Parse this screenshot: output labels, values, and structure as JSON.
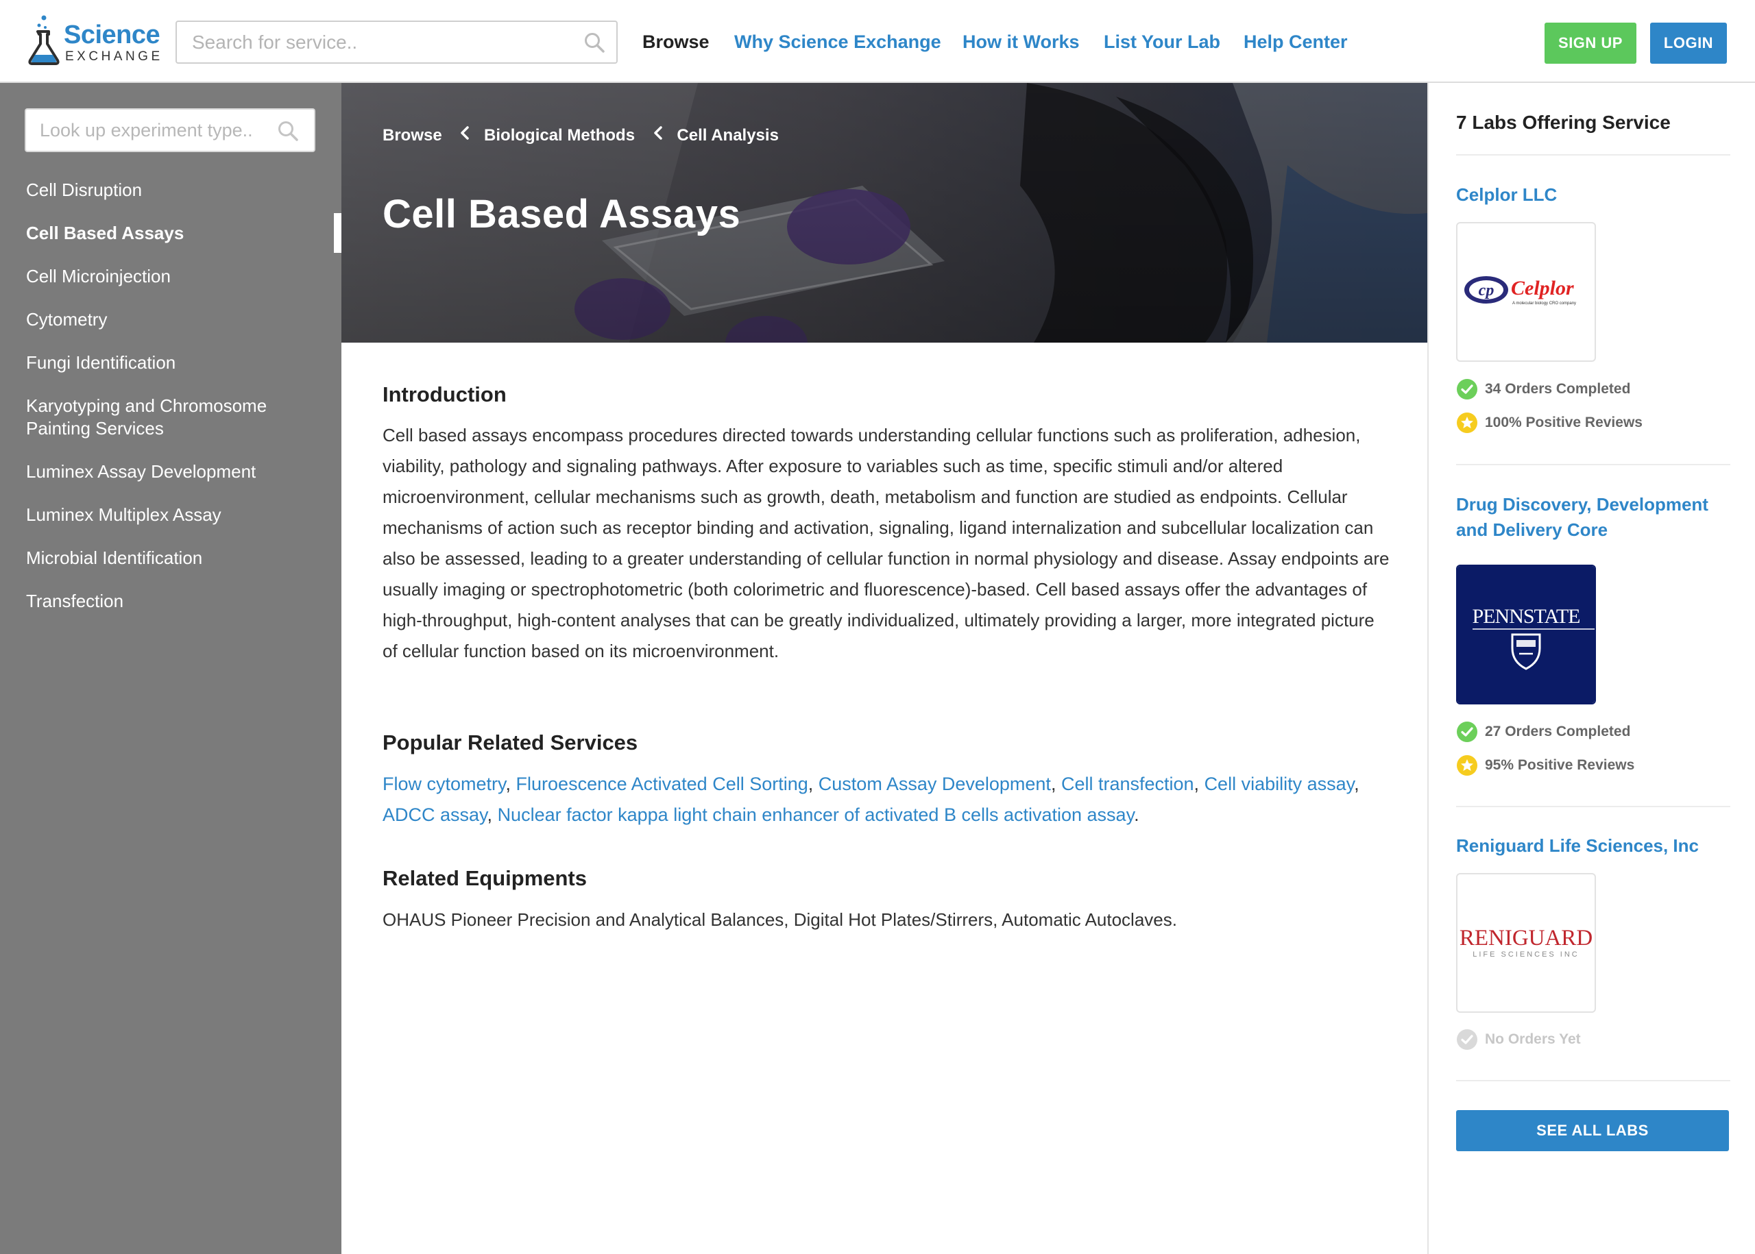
{
  "brand": {
    "name_top": "Science",
    "name_bottom": "EXCHANGE"
  },
  "header": {
    "search_placeholder": "Search for service..",
    "nav": [
      {
        "label": "Browse",
        "active": true
      },
      {
        "label": "Why Science Exchange",
        "active": false
      },
      {
        "label": "How it Works",
        "active": false
      },
      {
        "label": "List Your Lab",
        "active": false
      },
      {
        "label": "Help Center",
        "active": false
      }
    ],
    "signup_label": "SIGN UP",
    "login_label": "LOGIN"
  },
  "sidebar": {
    "search_placeholder": "Look up experiment type..",
    "items": [
      {
        "label": "Cell Disruption",
        "active": false
      },
      {
        "label": "Cell Based Assays",
        "active": true
      },
      {
        "label": "Cell Microinjection",
        "active": false
      },
      {
        "label": "Cytometry",
        "active": false
      },
      {
        "label": "Fungi Identification",
        "active": false
      },
      {
        "label": "Karyotyping and Chromosome Painting Services",
        "active": false
      },
      {
        "label": "Luminex Assay Development",
        "active": false
      },
      {
        "label": "Luminex Multiplex Assay",
        "active": false
      },
      {
        "label": "Microbial Identification",
        "active": false
      },
      {
        "label": "Transfection",
        "active": false
      }
    ]
  },
  "hero": {
    "breadcrumb": [
      "Browse",
      "Biological Methods",
      "Cell Analysis"
    ],
    "title": "Cell Based Assays"
  },
  "main": {
    "introduction": {
      "heading": "Introduction",
      "text": "Cell based assays encompass procedures directed towards understanding cellular functions such as proliferation, adhesion, viability, pathology and signaling pathways. After exposure to variables such as time, specific stimuli and/or altered microenvironment, cellular mechanisms such as growth, death, metabolism and function are studied as endpoints. Cellular mechanisms of action such as receptor binding and activation, signaling, ligand internalization and subcellular localization can also be assessed, leading to a greater understanding of cellular function in normal physiology and disease. Assay endpoints are usually imaging or spectrophotometric (both colorimetric and fluorescence)-based. Cell based assays offer the advantages of high-throughput, high-content analyses that can be greatly individualized, ultimately providing a larger, more integrated picture of cellular function based on its microenvironment."
    },
    "popular_related": {
      "heading": "Popular Related Services",
      "links": [
        "Flow cytometry",
        "Fluroescence Activated Cell Sorting",
        "Custom Assay Development",
        "Cell transfection",
        "Cell viability assay",
        "ADCC assay",
        "Nuclear factor kappa light chain enhancer of activated B cells activation assay"
      ]
    },
    "related_equipments": {
      "heading": "Related Equipments",
      "text": "OHAUS Pioneer Precision and Analytical Balances, Digital Hot Plates/Stirrers, Automatic Autoclaves."
    }
  },
  "labs_panel": {
    "heading": "7 Labs Offering Service",
    "labs": [
      {
        "name": "Celplor LLC",
        "logo_icon": "celplor-logo",
        "logo_text": {
          "initials": "cp",
          "word": "Celplor",
          "tagline": "A molecular biology CRO company"
        },
        "orders": "34 Orders Completed",
        "reviews": "100% Positive Reviews"
      },
      {
        "name": "Drug Discovery, Development and Delivery Core",
        "logo_icon": "pennstate-logo",
        "logo_text": {
          "word": "PENNSTATE"
        },
        "orders": "27 Orders Completed",
        "reviews": "95% Positive Reviews"
      },
      {
        "name": "Reniguard Life Sciences, Inc",
        "logo_icon": "reniguard-logo",
        "logo_text": {
          "word": "RENIGUARD",
          "tagline": "LIFE SCIENCES INC"
        },
        "orders": "No Orders Yet",
        "reviews": null
      }
    ],
    "see_all_label": "SEE ALL LABS"
  },
  "colors": {
    "link_blue": "#2e86c8",
    "signup_green": "#5cc85c",
    "sidebar_gray": "#7b7b7b",
    "check_green": "#6ccf5a",
    "star_yellow": "#f6cc1f"
  }
}
